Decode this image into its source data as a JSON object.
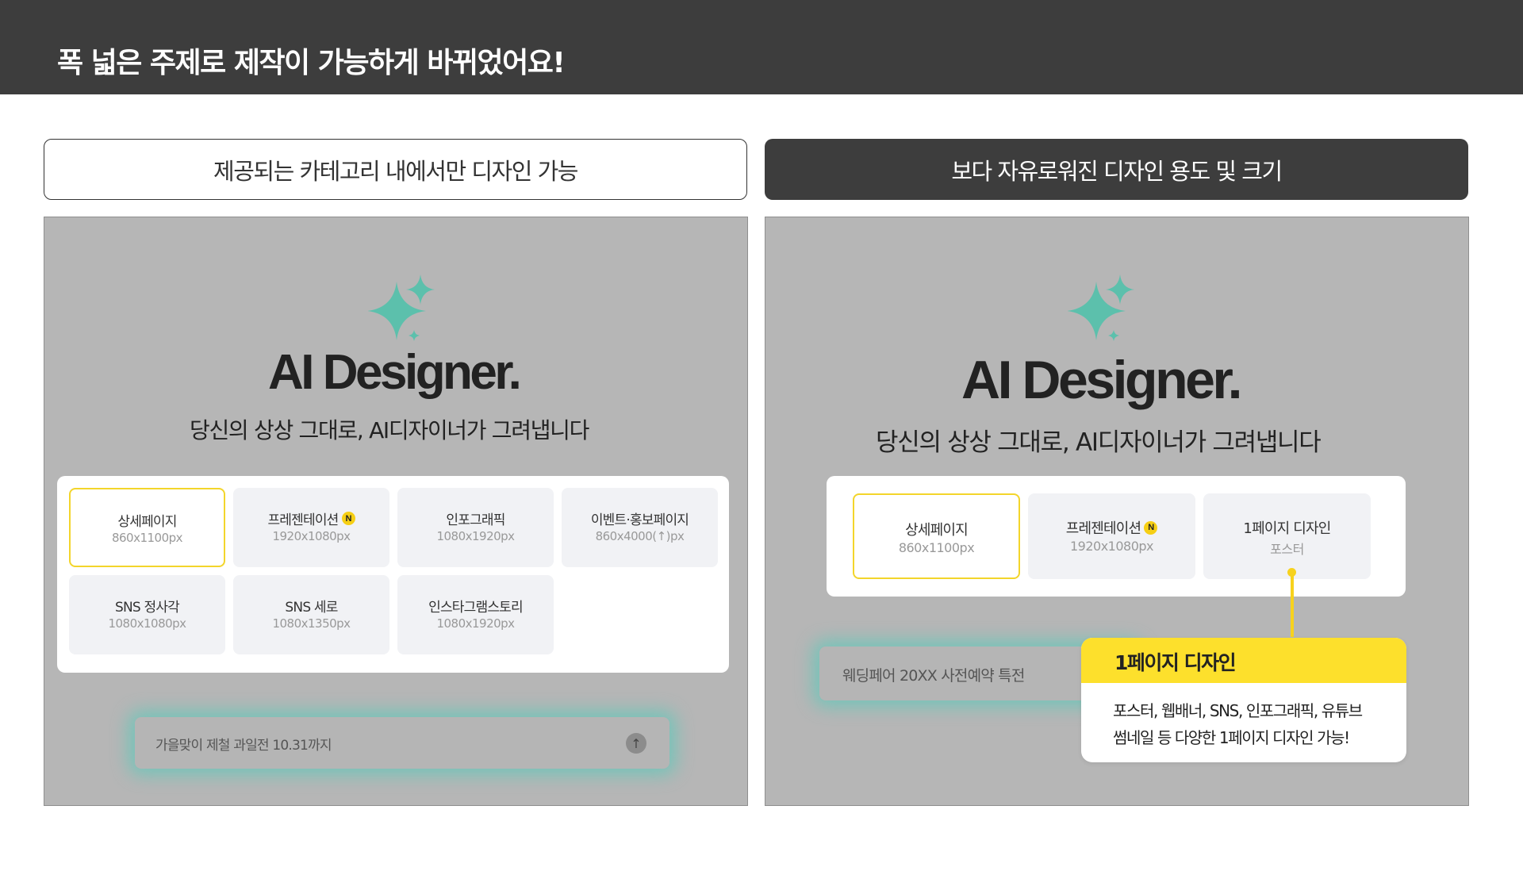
{
  "header": {
    "title": "폭 넓은 주제로 제작이 가능하게 바뀌었어요!"
  },
  "colors": {
    "accent_yellow": "#fde02c",
    "sparkle_teal": "#5cc0ac",
    "header_dark": "#3d3d3d",
    "panel_gray": "#b6b6b6"
  },
  "left": {
    "label": "제공되는 카테고리 내에서만 디자인 가능",
    "logo": "AI Designer.",
    "tagline": "당신의 상상 그대로, AI디자이너가 그려냅니다",
    "options": [
      {
        "name": "상세페이지",
        "size": "860x1100px",
        "badge": ""
      },
      {
        "name": "프레젠테이션",
        "size": "1920x1080px",
        "badge": "N"
      },
      {
        "name": "인포그래픽",
        "size": "1080x1920px",
        "badge": ""
      },
      {
        "name": "이벤트·홍보페이지",
        "size": "860x4000(↑)px",
        "badge": ""
      },
      {
        "name": "SNS 정사각",
        "size": "1080x1080px",
        "badge": ""
      },
      {
        "name": "SNS 세로",
        "size": "1080x1350px",
        "badge": ""
      },
      {
        "name": "인스타그램스토리",
        "size": "1080x1920px",
        "badge": ""
      }
    ],
    "prompt_text": "가을맞이 제철 과일전  10.31까지",
    "send_icon": "arrow-up-icon"
  },
  "right": {
    "label": "보다 자유로워진 디자인 용도 및 크기",
    "logo": "AI Designer.",
    "tagline": "당신의 상상 그대로, AI디자이너가 그려냅니다",
    "options": [
      {
        "name": "상세페이지",
        "size": "860x1100px",
        "badge": ""
      },
      {
        "name": "프레젠테이션",
        "size": "1920x1080px",
        "badge": "N"
      },
      {
        "name": "1페이지 디자인",
        "size": "포스터",
        "badge": ""
      }
    ],
    "prompt_text": "웨딩페어 20XX  사전예약 특전",
    "callout": {
      "title": "1페이지 디자인",
      "line1": "포스터, 웹배너, SNS, 인포그래픽, 유튜브",
      "line2": "썸네일 등 다양한 1페이지 디자인 가능!"
    }
  }
}
